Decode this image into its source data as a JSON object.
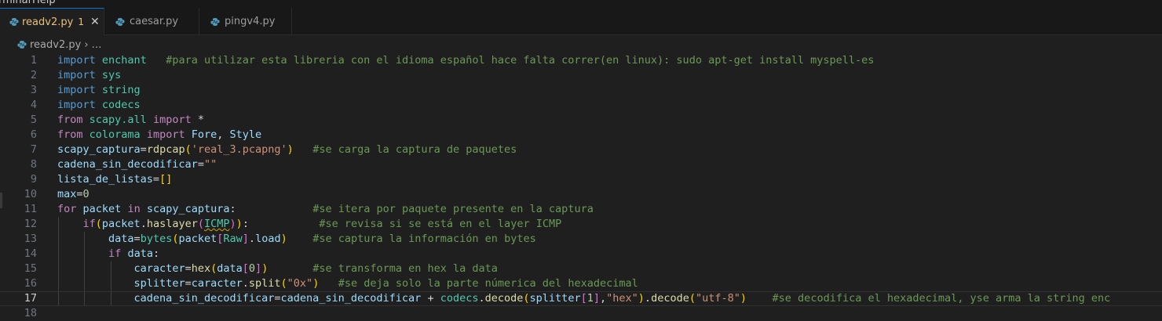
{
  "menu": {
    "items": [
      "rminal",
      "Help"
    ]
  },
  "tabs": [
    {
      "label": "readv2.py",
      "badge": "1",
      "active": true,
      "close": "✕"
    },
    {
      "label": "caesar.py",
      "active": false
    },
    {
      "label": "pingv4.py",
      "active": false
    }
  ],
  "breadcrumb": {
    "file": "readv2.py",
    "sep": "›",
    "more": "…"
  },
  "lines": [
    [
      [
        "k",
        "import"
      ],
      [
        "w",
        " "
      ],
      [
        "mod",
        "enchant"
      ],
      [
        "w",
        "   "
      ],
      [
        "c",
        "#para utilizar esta libreria con el idioma español hace falta correr(en linux): sudo apt-get install myspell-es"
      ]
    ],
    [
      [
        "k",
        "import"
      ],
      [
        "w",
        " "
      ],
      [
        "mod",
        "sys"
      ]
    ],
    [
      [
        "k",
        "import"
      ],
      [
        "w",
        " "
      ],
      [
        "mod",
        "string"
      ]
    ],
    [
      [
        "k",
        "import"
      ],
      [
        "w",
        " "
      ],
      [
        "mod",
        "codecs"
      ]
    ],
    [
      [
        "kc",
        "from"
      ],
      [
        "w",
        " "
      ],
      [
        "mod",
        "scapy.all"
      ],
      [
        "w",
        " "
      ],
      [
        "kc",
        "import"
      ],
      [
        "w",
        " *"
      ]
    ],
    [
      [
        "kc",
        "from"
      ],
      [
        "w",
        " "
      ],
      [
        "mod",
        "colorama"
      ],
      [
        "w",
        " "
      ],
      [
        "kc",
        "import"
      ],
      [
        "w",
        " "
      ],
      [
        "v",
        "Fore"
      ],
      [
        "w",
        ", "
      ],
      [
        "v",
        "Style"
      ]
    ],
    [
      [
        "v",
        "scapy_captura"
      ],
      [
        "w",
        "="
      ],
      [
        "fn",
        "rdpcap"
      ],
      [
        "p1",
        "("
      ],
      [
        "s",
        "'real_3.pcapng'"
      ],
      [
        "p1",
        ")"
      ],
      [
        "w",
        "   "
      ],
      [
        "c",
        "#se carga la captura de paquetes"
      ]
    ],
    [
      [
        "v",
        "cadena_sin_decodificar"
      ],
      [
        "w",
        "="
      ],
      [
        "s",
        "\"\""
      ]
    ],
    [
      [
        "v",
        "lista_de_listas"
      ],
      [
        "w",
        "="
      ],
      [
        "p1",
        "[]"
      ]
    ],
    [
      [
        "v",
        "max"
      ],
      [
        "w",
        "="
      ],
      [
        "n",
        "0"
      ]
    ],
    [
      [
        "kc",
        "for"
      ],
      [
        "w",
        " "
      ],
      [
        "v",
        "packet"
      ],
      [
        "w",
        " "
      ],
      [
        "kc",
        "in"
      ],
      [
        "w",
        " "
      ],
      [
        "v",
        "scapy_captura"
      ],
      [
        "w",
        ":            "
      ],
      [
        "c",
        "#se itera por paquete presente en la captura"
      ]
    ],
    [
      [
        "w",
        "    "
      ],
      [
        "kc",
        "if"
      ],
      [
        "p1",
        "("
      ],
      [
        "v",
        "packet"
      ],
      [
        "w",
        "."
      ],
      [
        "fn",
        "haslayer"
      ],
      [
        "p2",
        "("
      ],
      [
        "cls",
        "ICMP",
        "squig"
      ],
      [
        "p2",
        ")"
      ],
      [
        "p1",
        ")"
      ],
      [
        "w",
        ":           "
      ],
      [
        "c",
        "#se revisa si se está en el layer ICMP"
      ]
    ],
    [
      [
        "w",
        "        "
      ],
      [
        "v",
        "data"
      ],
      [
        "w",
        "="
      ],
      [
        "cls",
        "bytes"
      ],
      [
        "p1",
        "("
      ],
      [
        "v",
        "packet"
      ],
      [
        "p2",
        "["
      ],
      [
        "cls",
        "Raw"
      ],
      [
        "p2",
        "]"
      ],
      [
        "w",
        "."
      ],
      [
        "v",
        "load"
      ],
      [
        "p1",
        ")"
      ],
      [
        "w",
        "    "
      ],
      [
        "c",
        "#se captura la información en bytes"
      ]
    ],
    [
      [
        "w",
        "        "
      ],
      [
        "kc",
        "if"
      ],
      [
        "w",
        " "
      ],
      [
        "v",
        "data"
      ],
      [
        "w",
        ":"
      ]
    ],
    [
      [
        "w",
        "            "
      ],
      [
        "v",
        "caracter"
      ],
      [
        "w",
        "="
      ],
      [
        "fn",
        "hex"
      ],
      [
        "p1",
        "("
      ],
      [
        "v",
        "data"
      ],
      [
        "p2",
        "["
      ],
      [
        "n",
        "0"
      ],
      [
        "p2",
        "]"
      ],
      [
        "p1",
        ")"
      ],
      [
        "w",
        "       "
      ],
      [
        "c",
        "#se transforma en hex la data"
      ]
    ],
    [
      [
        "w",
        "            "
      ],
      [
        "v",
        "splitter"
      ],
      [
        "w",
        "="
      ],
      [
        "v",
        "caracter"
      ],
      [
        "w",
        "."
      ],
      [
        "fn",
        "split"
      ],
      [
        "p1",
        "("
      ],
      [
        "s",
        "\"0x\""
      ],
      [
        "p1",
        ")"
      ],
      [
        "w",
        "   "
      ],
      [
        "c",
        "#se deja solo la parte númerica del hexadecimal"
      ]
    ],
    [
      [
        "w",
        "            "
      ],
      [
        "v",
        "cadena_sin_decodificar"
      ],
      [
        "w",
        "="
      ],
      [
        "v",
        "cadena_sin_decodificar"
      ],
      [
        "w",
        " + "
      ],
      [
        "mod",
        "codecs"
      ],
      [
        "w",
        "."
      ],
      [
        "fn",
        "decode"
      ],
      [
        "p1",
        "("
      ],
      [
        "v",
        "splitter"
      ],
      [
        "p2",
        "["
      ],
      [
        "n",
        "1"
      ],
      [
        "p2",
        "]"
      ],
      [
        "w",
        ","
      ],
      [
        "s",
        "\"hex\""
      ],
      [
        "p1",
        ")"
      ],
      [
        "w",
        "."
      ],
      [
        "fn",
        "decode"
      ],
      [
        "p1",
        "("
      ],
      [
        "s",
        "\"utf-8\""
      ],
      [
        "p1",
        ")"
      ],
      [
        "w",
        "    "
      ],
      [
        "c",
        "#se decodifica el hexadecimal, yse arma la string enc"
      ]
    ],
    []
  ],
  "line_numbers": [
    "1",
    "2",
    "3",
    "4",
    "5",
    "6",
    "7",
    "8",
    "9",
    "10",
    "11",
    "12",
    "13",
    "14",
    "15",
    "16",
    "17",
    "18"
  ],
  "current_line": 17
}
